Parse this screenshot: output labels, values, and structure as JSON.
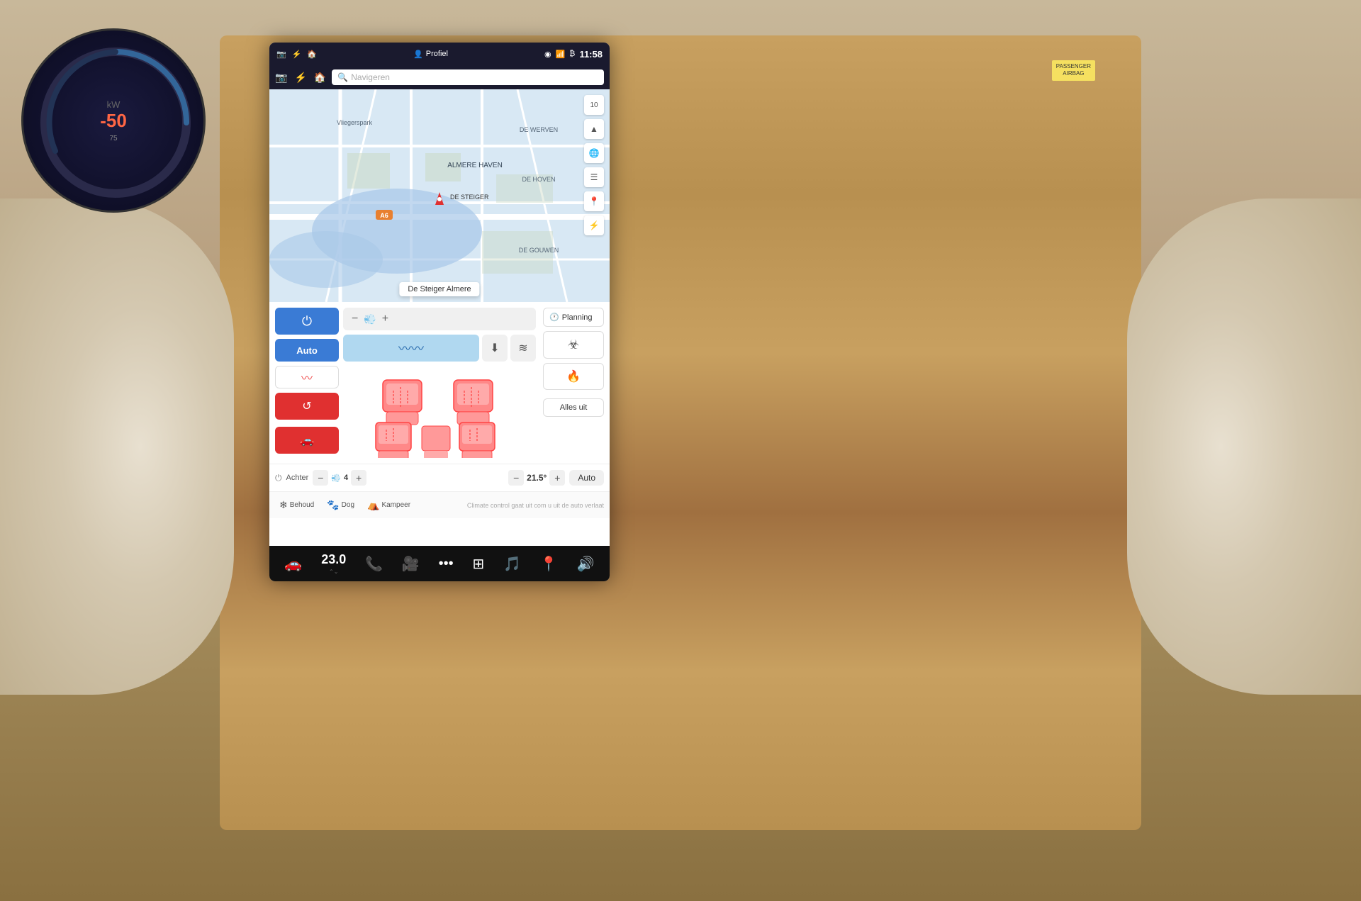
{
  "dashboard": {
    "background_color": "#c8a060"
  },
  "status_bar": {
    "icons": [
      "📷",
      "⚡",
      "🏠"
    ],
    "profile_label": "Profiel",
    "time": "11:58",
    "signal_icon": "📶",
    "bluetooth_icon": "🔵",
    "gps_icon": "⭕"
  },
  "nav_bar": {
    "search_placeholder": "Navigeren"
  },
  "map": {
    "location_name": "De Steiger",
    "city": "Almere",
    "area_label": "ALMERE HAVEN",
    "marker_color": "#e03030"
  },
  "climate": {
    "power_button_icon": "⏻",
    "auto_label": "Auto",
    "heat_icon": "〰",
    "fan_value": "4",
    "temperature": "21.5°",
    "temp_minus_icon": "−",
    "temp_plus_icon": "+",
    "auto_btn_label": "Auto",
    "planning_label": "Planning",
    "alles_uit_label": "Alles uit",
    "power_icon": "⏻",
    "fan_minus": "−",
    "fan_plus": "+"
  },
  "presets": {
    "behoud_label": "Behoud",
    "dog_label": "Dog",
    "kampeer_label": "Kampeer",
    "note": "Climate control gaat uit com u uit de auto verlaat"
  },
  "bottom_bar": {
    "car_icon": "🚗",
    "temperature": "23.0",
    "phone_icon": "📞",
    "camera_icon": "🎥",
    "dots_icon": "•••",
    "grid_icon": "⊞",
    "spotify_icon": "🎵",
    "map_icon": "📍",
    "volume_icon": "🔊",
    "sub_arrows": "⌃⌄"
  },
  "bottom_temp_row": {
    "achter_label": "Achter",
    "fan_value": "4",
    "temp_value": "21.5°"
  }
}
